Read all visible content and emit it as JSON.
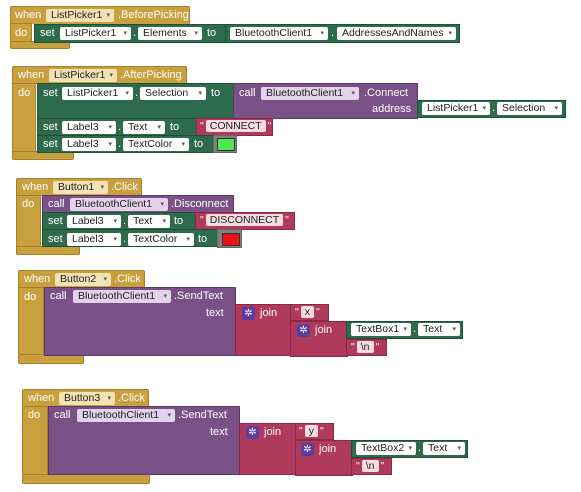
{
  "blocks": [
    {
      "when": "when",
      "component": "ListPicker1",
      "event": ".BeforePicking",
      "do": "do",
      "set": "set",
      "target": "ListPicker1",
      "property": "Elements",
      "to": "to",
      "value_component": "BluetoothClient1",
      "value_property": "AddressesAndNames"
    },
    {
      "when": "when",
      "component": "ListPicker1",
      "event": ".AfterPicking",
      "do": "do",
      "stmt1": {
        "set": "set",
        "target": "ListPicker1",
        "property": "Selection",
        "to": "to",
        "call": "call",
        "call_component": "BluetoothClient1",
        "method": ".Connect",
        "arg_label": "address",
        "arg_component": "ListPicker1",
        "arg_property": "Selection"
      },
      "stmt2": {
        "set": "set",
        "target": "Label3",
        "property": "Text",
        "to": "to",
        "quote_open": "\"",
        "text": "CONNECT",
        "quote_close": "\""
      },
      "stmt3": {
        "set": "set",
        "target": "Label3",
        "property": "TextColor",
        "to": "to",
        "color": "#4de84d"
      }
    },
    {
      "when": "when",
      "component": "Button1",
      "event": ".Click",
      "do": "do",
      "stmt1": {
        "call": "call",
        "call_component": "BluetoothClient1",
        "method": ".Disconnect"
      },
      "stmt2": {
        "set": "set",
        "target": "Label3",
        "property": "Text",
        "to": "to",
        "quote_open": "\"",
        "text": "DISCONNECT",
        "quote_close": "\""
      },
      "stmt3": {
        "set": "set",
        "target": "Label3",
        "property": "TextColor",
        "to": "to",
        "color": "#ee1111"
      }
    },
    {
      "when": "when",
      "component": "Button2",
      "event": ".Click",
      "do": "do",
      "call": "call",
      "call_component": "BluetoothClient1",
      "method": ".SendText",
      "arg_label": "text",
      "join1": "join",
      "str1_q1": "\"",
      "str1": "x",
      "str1_q2": "\"",
      "join2": "join",
      "textbox": "TextBox1",
      "textbox_property": "Text",
      "str2_q1": "\"",
      "str2": "\\n",
      "str2_q2": "\""
    },
    {
      "when": "when",
      "component": "Button3",
      "event": ".Click",
      "do": "do",
      "call": "call",
      "call_component": "BluetoothClient1",
      "method": ".SendText",
      "arg_label": "text",
      "join1": "join",
      "str1_q1": "\"",
      "str1": "y",
      "str1_q2": "\"",
      "join2": "join",
      "textbox": "TextBox2",
      "textbox_property": "Text",
      "str2_q1": "\"",
      "str2": "\\n",
      "str2_q2": "\""
    }
  ],
  "dropdown_arrow": "▾",
  "mutator_icon": "gear-icon",
  "colors": {
    "event": "#c8a03e",
    "setter": "#2e6b4b",
    "call": "#7a5187",
    "text": "#b03a5b",
    "join_gear": "#5a3fa0"
  }
}
